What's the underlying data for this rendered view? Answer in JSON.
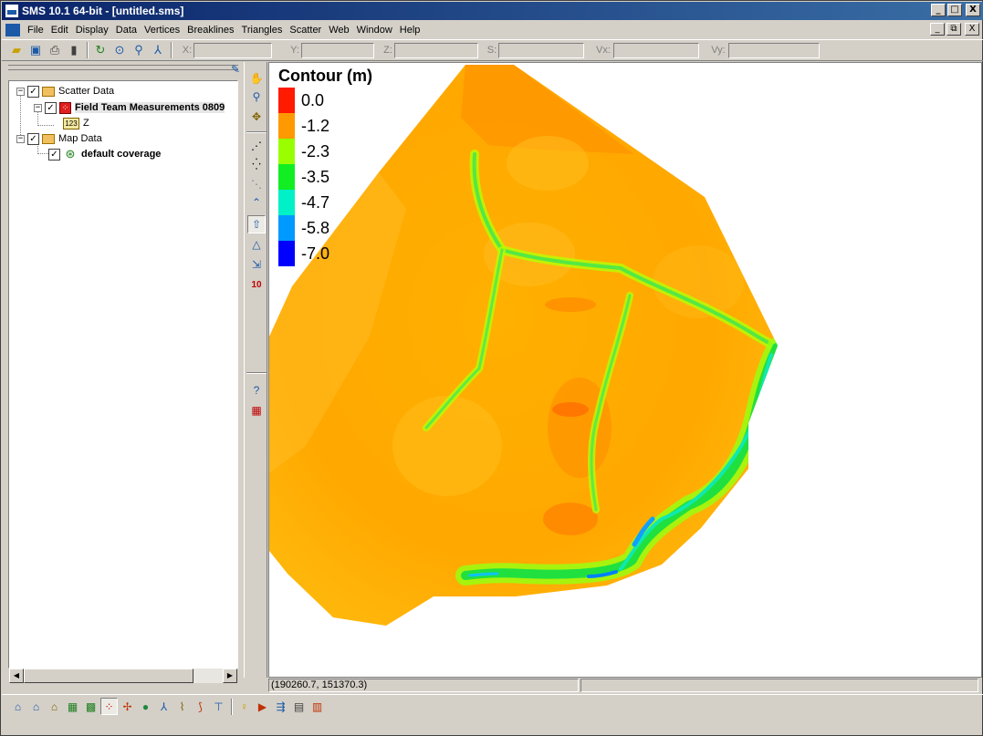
{
  "window": {
    "title": "SMS 10.1 64-bit - [untitled.sms]"
  },
  "window_buttons": [
    "_",
    "□",
    "X"
  ],
  "mdi_buttons": [
    "_",
    "⧉",
    "X"
  ],
  "menu": [
    "File",
    "Edit",
    "Display",
    "Data",
    "Vertices",
    "Breaklines",
    "Triangles",
    "Scatter",
    "Web",
    "Window",
    "Help"
  ],
  "coords": {
    "x_label": "X:",
    "y_label": "Y:",
    "z_label": "Z:",
    "s_label": "S:",
    "vx_label": "Vx:",
    "vy_label": "Vy:"
  },
  "tree": {
    "scatter_root": "Scatter Data",
    "scatter_set": "Field Team Measurements 0809",
    "dataset": "Z",
    "dataset_icon_text": "123",
    "map_root": "Map Data",
    "coverage": "default coverage"
  },
  "status": {
    "cursor": "(190260.7, 151370.3)"
  },
  "legend": {
    "title": "Contour (m)",
    "entries": [
      {
        "label": "0.0",
        "color": "#ff1a00"
      },
      {
        "label": "-1.2",
        "color": "#ff9900"
      },
      {
        "label": "-2.3",
        "color": "#99ff00"
      },
      {
        "label": "-3.5",
        "color": "#11ee22"
      },
      {
        "label": "-4.7",
        "color": "#00f0c8"
      },
      {
        "label": "-5.8",
        "color": "#0099ff"
      },
      {
        "label": "-7.0",
        "color": "#0000ff"
      }
    ]
  },
  "chart_data": {
    "type": "heatmap",
    "title": "Contour (m)",
    "legend_values": [
      0.0,
      -1.2,
      -2.3,
      -3.5,
      -4.7,
      -5.8,
      -7.0
    ],
    "legend_position": "top-left"
  },
  "colors": {
    "titlebar": "#0a246a",
    "dominant_field": "#ffa500",
    "channel": "#44e83a"
  }
}
